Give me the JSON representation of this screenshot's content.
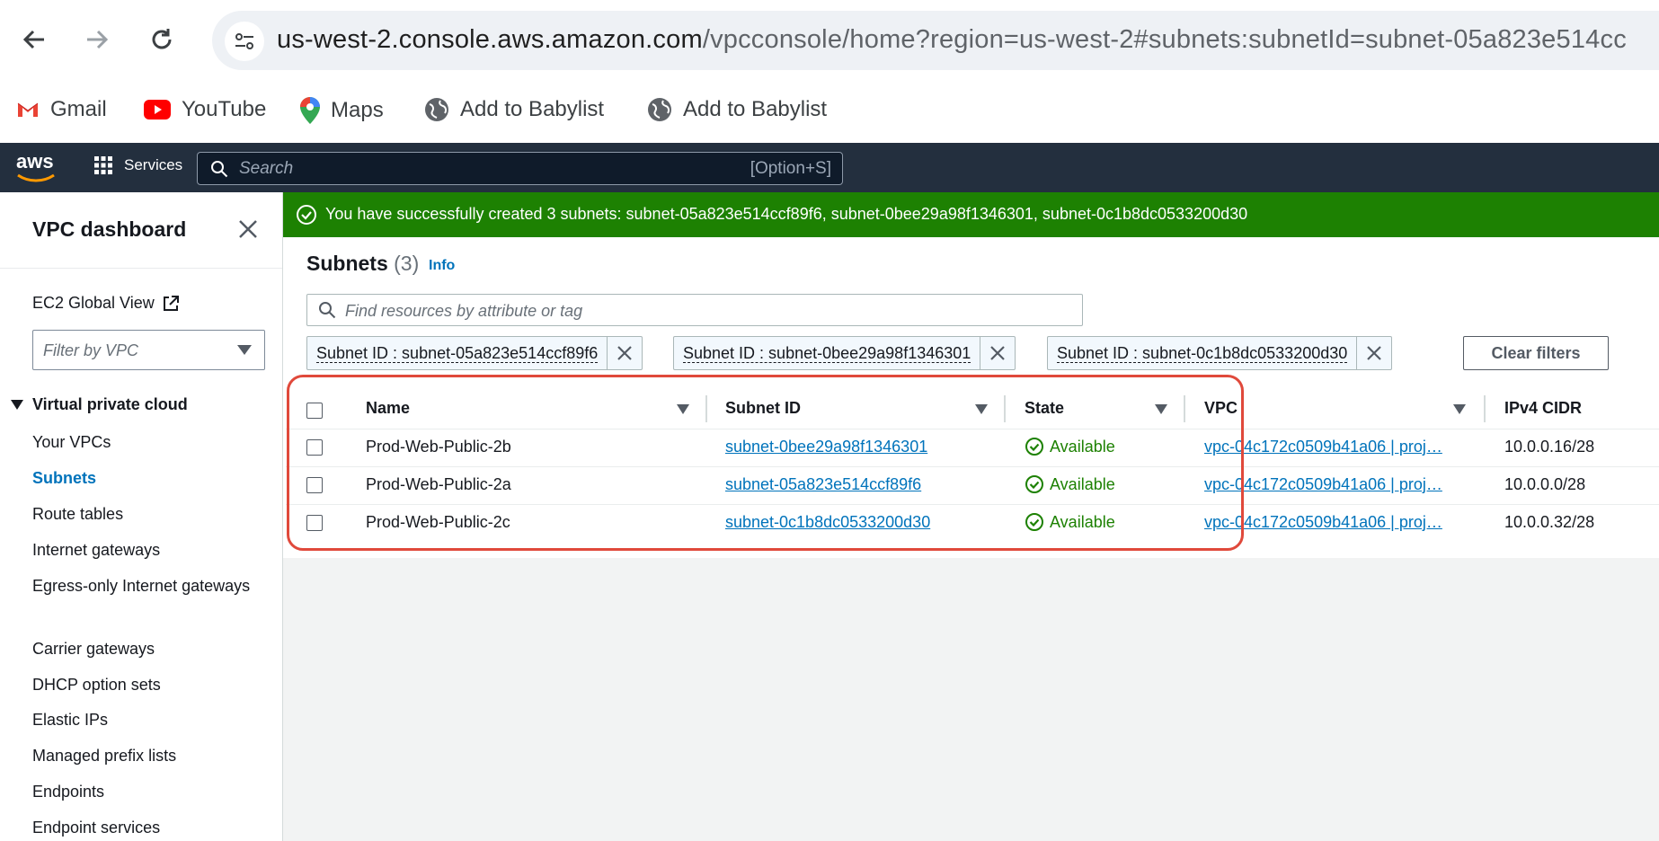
{
  "browser": {
    "url_host": "us-west-2.console.aws.amazon.com",
    "url_path": "/vpcconsole/home?region=us-west-2#subnets:subnetId=subnet-05a823e514cc",
    "bookmarks": [
      "Gmail",
      "YouTube",
      "Maps",
      "Add to Babylist",
      "Add to Babylist"
    ]
  },
  "aws": {
    "logo": "aws",
    "services_label": "Services",
    "search_placeholder": "Search",
    "search_shortcut": "[Option+S]"
  },
  "sidebar": {
    "title": "VPC dashboard",
    "ec2_global_view": "EC2 Global View",
    "filter_placeholder": "Filter by VPC",
    "section": "Virtual private cloud",
    "items": [
      "Your VPCs",
      "Subnets",
      "Route tables",
      "Internet gateways",
      "Egress-only Internet gateways",
      "Carrier gateways",
      "DHCP option sets",
      "Elastic IPs",
      "Managed prefix lists",
      "Endpoints",
      "Endpoint services"
    ],
    "active_item": "Subnets"
  },
  "banner": {
    "message": "You have successfully created 3 subnets: subnet-05a823e514ccf89f6, subnet-0bee29a98f1346301, subnet-0c1b8dc0533200d30",
    "color": "#1d8102"
  },
  "main": {
    "title": "Subnets",
    "count": "(3)",
    "info": "Info",
    "search_placeholder": "Find resources by attribute or tag",
    "filters": [
      "Subnet ID : subnet-05a823e514ccf89f6",
      "Subnet ID : subnet-0bee29a98f1346301",
      "Subnet ID : subnet-0c1b8dc0533200d30"
    ],
    "clear_filters": "Clear filters",
    "columns": [
      "Name",
      "Subnet ID",
      "State",
      "VPC",
      "IPv4 CIDR"
    ],
    "rows": [
      {
        "name": "Prod-Web-Public-2b",
        "subnet_id": "subnet-0bee29a98f1346301",
        "state": "Available",
        "vpc": "vpc-04c172c0509b41a06 | proj…",
        "cidr": "10.0.0.16/28"
      },
      {
        "name": "Prod-Web-Public-2a",
        "subnet_id": "subnet-05a823e514ccf89f6",
        "state": "Available",
        "vpc": "vpc-04c172c0509b41a06 | proj…",
        "cidr": "10.0.0.0/28"
      },
      {
        "name": "Prod-Web-Public-2c",
        "subnet_id": "subnet-0c1b8dc0533200d30",
        "state": "Available",
        "vpc": "vpc-04c172c0509b41a06 | proj…",
        "cidr": "10.0.0.32/28"
      }
    ]
  }
}
